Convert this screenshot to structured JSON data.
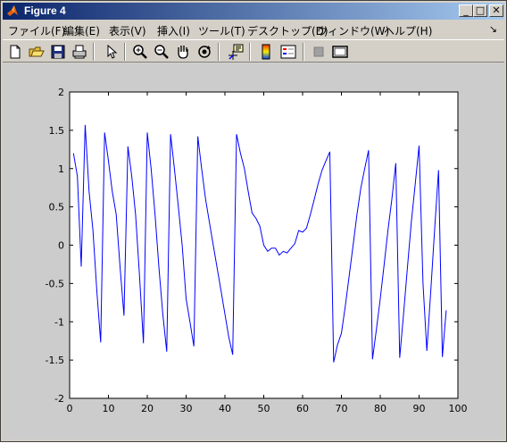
{
  "window": {
    "title": "Figure 4"
  },
  "titlebar_buttons": {
    "minimize": "_",
    "maximize": "□",
    "close": "✕"
  },
  "menu": {
    "items": [
      "ファイル(F)",
      "編集(E)",
      "表示(V)",
      "挿入(I)",
      "ツール(T)",
      "デスクトップ(D)",
      "ウィンドウ(W)",
      "ヘルプ(H)"
    ],
    "overflow": "↘"
  },
  "toolbar": {
    "icons": [
      "new-figure-icon",
      "open-file-icon",
      "save-icon",
      "print-icon",
      "edit-plot-arrow-icon",
      "zoom-in-icon",
      "zoom-out-icon",
      "pan-hand-icon",
      "rotate-3d-icon",
      "data-cursor-icon",
      "colorbar-icon",
      "legend-icon",
      "hide-plot-tools-icon",
      "show-plot-tools-icon"
    ]
  },
  "chart_data": {
    "type": "line",
    "color": "#0000ff",
    "xlim": [
      0,
      100
    ],
    "ylim": [
      -2,
      2
    ],
    "xticks": [
      0,
      10,
      20,
      30,
      40,
      50,
      60,
      70,
      80,
      90,
      100
    ],
    "yticks": [
      2,
      1.5,
      1,
      0.5,
      0,
      -0.5,
      -1,
      -1.5,
      -2
    ],
    "x": [
      1,
      2,
      3,
      4,
      5,
      6,
      7,
      8,
      9,
      10,
      11,
      12,
      13,
      14,
      15,
      16,
      17,
      18,
      19,
      20,
      21,
      22,
      23,
      24,
      25,
      26,
      27,
      28,
      29,
      30,
      31,
      32,
      33,
      34,
      35,
      36,
      37,
      38,
      39,
      40,
      41,
      42,
      43,
      44,
      45,
      46,
      47,
      48,
      49,
      50,
      51,
      52,
      53,
      54,
      55,
      56,
      57,
      58,
      59,
      60,
      61,
      62,
      63,
      64,
      65,
      66,
      67,
      68,
      69,
      70,
      71,
      72,
      73,
      74,
      75,
      76,
      77,
      78,
      79,
      80,
      81,
      82,
      83,
      84,
      85,
      86,
      87,
      88,
      89,
      90,
      91,
      92,
      93,
      94,
      95,
      96,
      97,
      98,
      99
    ],
    "y": [
      1.2,
      0.9,
      -0.28,
      1.57,
      0.7,
      0.2,
      -0.6,
      -1.27,
      1.47,
      1.1,
      0.7,
      0.4,
      -0.3,
      -0.92,
      1.29,
      0.9,
      0.4,
      -0.4,
      -1.28,
      1.47,
      1.0,
      0.4,
      -0.3,
      -0.9,
      -1.39,
      1.45,
      1.0,
      0.5,
      0.0,
      -0.7,
      -1.0,
      -1.32,
      1.42,
      1.0,
      0.6,
      0.3,
      0.0,
      -0.3,
      -0.6,
      -0.9,
      -1.2,
      -1.43,
      1.45,
      1.2,
      1.0,
      0.7,
      0.42,
      0.35,
      0.25,
      0.0,
      -0.08,
      -0.04,
      -0.04,
      -0.13,
      -0.08,
      -0.1,
      -0.04,
      0.02,
      0.19,
      0.17,
      0.22,
      0.4,
      0.6,
      0.8,
      0.98,
      1.1,
      1.22,
      -1.53,
      -1.3,
      -1.15,
      -0.8,
      -0.4,
      0.0,
      0.4,
      0.75,
      1.0,
      1.24,
      -1.49,
      -1.1,
      -0.7,
      -0.25,
      0.2,
      0.6,
      1.07,
      -1.47,
      -0.9,
      -0.3,
      0.3,
      0.8,
      1.3,
      -0.5,
      -1.38,
      -0.6,
      0.2,
      0.98,
      -1.46,
      -0.85
    ]
  }
}
